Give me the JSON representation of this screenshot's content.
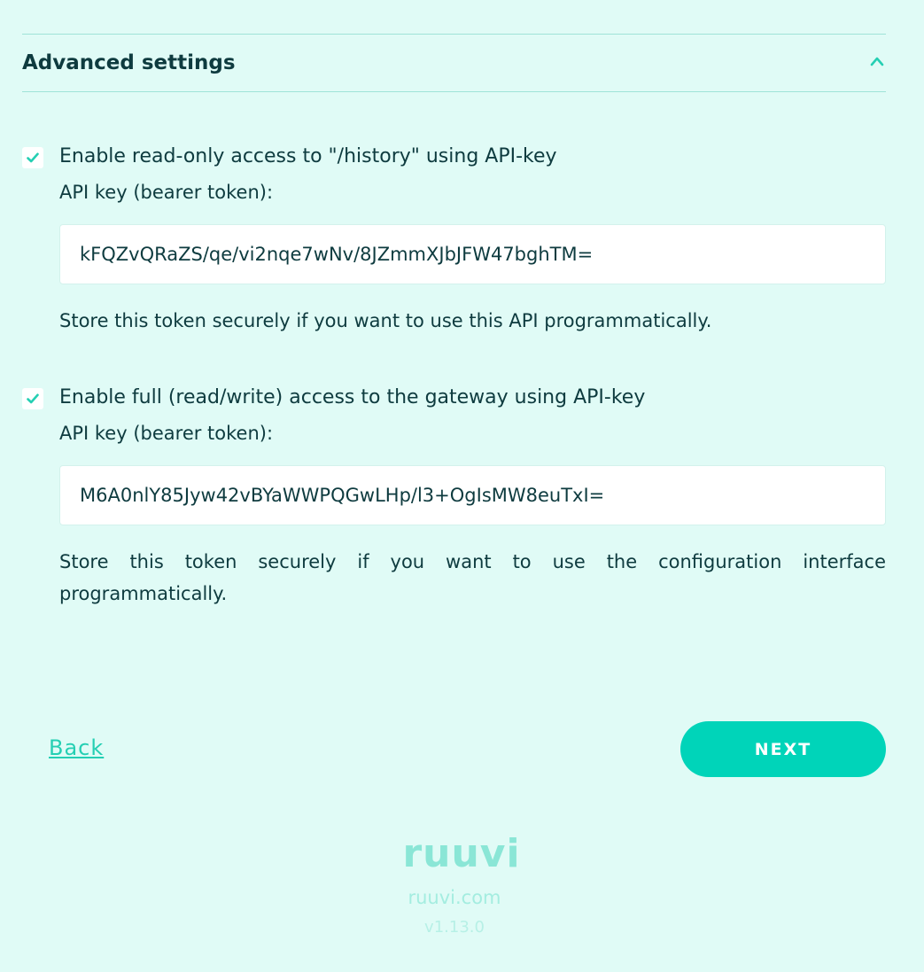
{
  "advanced": {
    "title": "Advanced settings",
    "expanded": true,
    "toggle_icon": "chevron-up-icon"
  },
  "read_access": {
    "checked": true,
    "label": "Enable read-only access to \"/history\" using API-key",
    "key_label": "API key (bearer token):",
    "key_value": "kFQZvQRaZS/qe/vi2nqe7wNv/8JZmmXJbJFW47bghTM=",
    "hint": "Store this token securely if you want to use this API programmatically."
  },
  "full_access": {
    "checked": true,
    "label": "Enable full (read/write) access to the gateway using API-key",
    "key_label": "API key (bearer token):",
    "key_value": "M6A0nlY85Jyw42vBYaWWPQGwLHp/l3+OgIsMW8euTxI=",
    "hint": "Store this token securely if you want to use the configuration interface programmatically."
  },
  "nav": {
    "back_label": "Back",
    "next_label": "NEXT"
  },
  "footer": {
    "logo_text": "ruuvi",
    "link": "ruuvi.com",
    "version": "v1.13.0"
  },
  "colors": {
    "background": "#e0fbf6",
    "accent": "#00d4b9",
    "text": "#0e3b3f",
    "link": "#25cfb3"
  }
}
